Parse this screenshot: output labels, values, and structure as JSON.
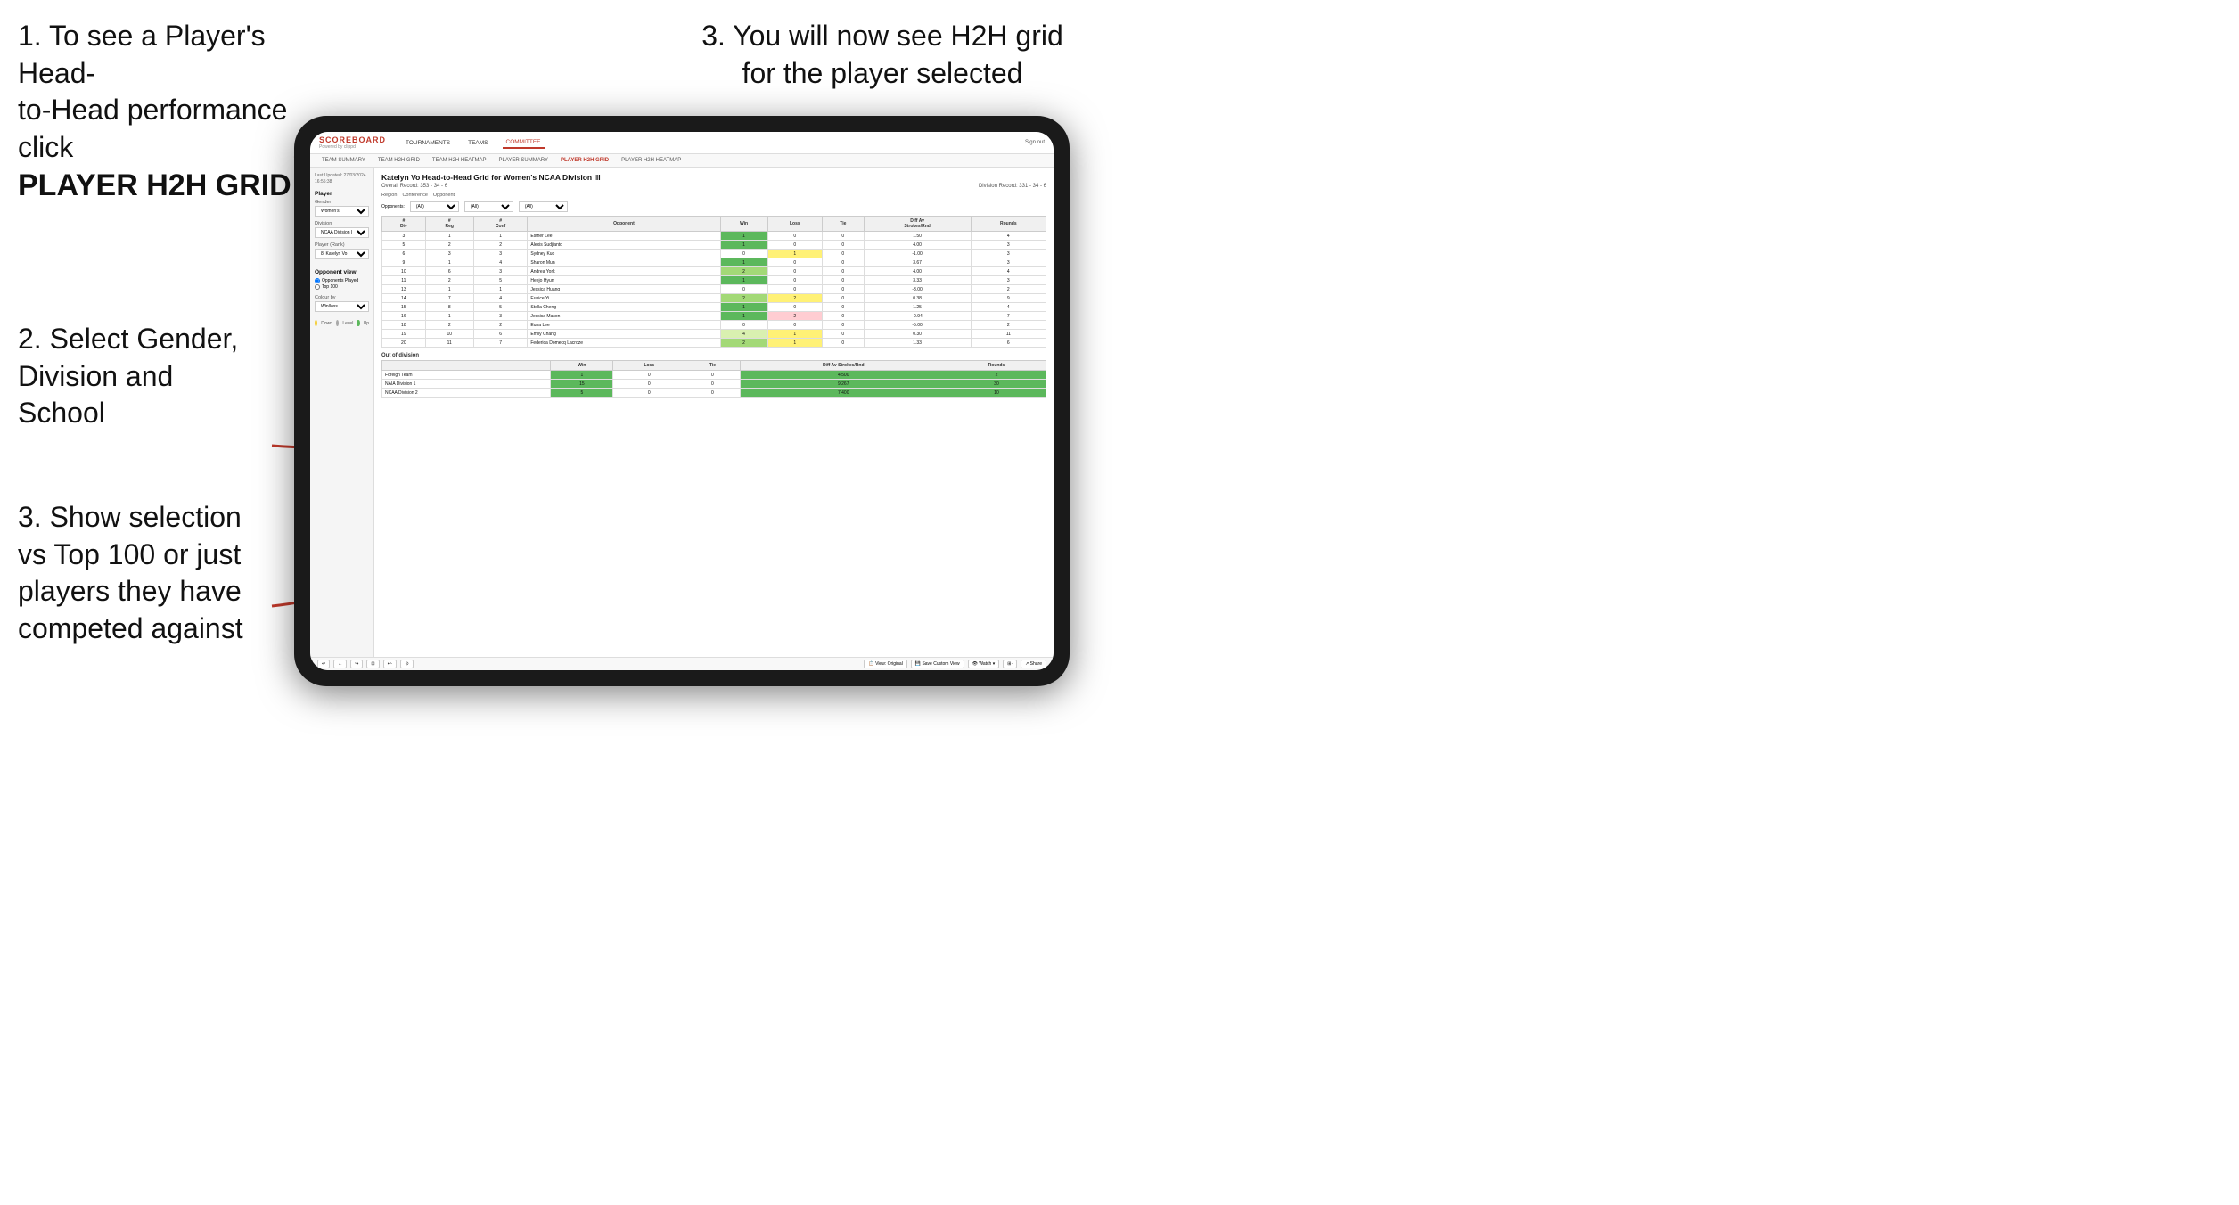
{
  "instructions": {
    "top_left_line1": "1. To see a Player's Head-",
    "top_left_line2": "to-Head performance click",
    "top_left_bold": "PLAYER H2H GRID",
    "top_right": "3. You will now see H2H grid\nfor the player selected",
    "mid_left_line1": "2. Select Gender,",
    "mid_left_line2": "Division and",
    "mid_left_line3": "School",
    "bottom_left_line1": "3. Show selection",
    "bottom_left_line2": "vs Top 100 or just",
    "bottom_left_line3": "players they have",
    "bottom_left_line4": "competed against"
  },
  "nav": {
    "logo": "SCOREBOARD",
    "logo_sub": "Powered by clippd",
    "items": [
      "TOURNAMENTS",
      "TEAMS",
      "COMMITTEE"
    ],
    "sign_out": "Sign out"
  },
  "sub_nav": {
    "items": [
      "TEAM SUMMARY",
      "TEAM H2H GRID",
      "TEAM H2H HEATMAP",
      "PLAYER SUMMARY",
      "PLAYER H2H GRID",
      "PLAYER H2H HEATMAP"
    ],
    "active": "PLAYER H2H GRID"
  },
  "sidebar": {
    "timestamp": "Last Updated: 27/03/2024\n16:55:38",
    "player_section": "Player",
    "gender_label": "Gender",
    "gender_value": "Women's",
    "division_label": "Division",
    "division_value": "NCAA Division III",
    "player_rank_label": "Player (Rank)",
    "player_rank_value": "8. Katelyn Vo",
    "opponent_view_label": "Opponent view",
    "radio_opponents": "Opponents Played",
    "radio_top100": "Top 100",
    "colour_by_label": "Colour by",
    "colour_value": "Win/loss",
    "colour_legend": [
      {
        "color": "#f4d03f",
        "label": "Down"
      },
      {
        "color": "#aaa",
        "label": "Level"
      },
      {
        "color": "#5cb85c",
        "label": "Up"
      }
    ]
  },
  "grid": {
    "title": "Katelyn Vo Head-to-Head Grid for Women's NCAA Division III",
    "overall_record": "Overall Record: 353 - 34 - 6",
    "division_record": "Division Record: 331 - 34 - 6",
    "filter_opponents_label": "Opponents:",
    "filter_opponents_value": "(All)",
    "filter_conference_label": "Conference",
    "filter_conference_value": "(All)",
    "filter_opponent_label": "Opponent",
    "filter_opponent_value": "(All)",
    "region_label": "Region",
    "conference_label": "Conference",
    "opponent_label": "Opponent",
    "columns": [
      "# Div",
      "# Reg",
      "# Conf",
      "Opponent",
      "Win",
      "Loss",
      "Tie",
      "Diff Av Strokes/Rnd",
      "Rounds"
    ],
    "rows": [
      {
        "div": 3,
        "reg": 1,
        "conf": 1,
        "opponent": "Esther Lee",
        "win": 1,
        "loss": 0,
        "tie": 0,
        "diff": 1.5,
        "rounds": 4,
        "win_color": "green-dark",
        "loss_color": "white",
        "tie_color": "white"
      },
      {
        "div": 5,
        "reg": 2,
        "conf": 2,
        "opponent": "Alexis Sudjianto",
        "win": 1,
        "loss": 0,
        "tie": 0,
        "diff": 4.0,
        "rounds": 3,
        "win_color": "green-dark",
        "loss_color": "white",
        "tie_color": "white"
      },
      {
        "div": 6,
        "reg": 3,
        "conf": 3,
        "opponent": "Sydney Kuo",
        "win": 0,
        "loss": 1,
        "tie": 0,
        "diff": -1.0,
        "rounds": 3,
        "win_color": "white",
        "loss_color": "yellow",
        "tie_color": "white"
      },
      {
        "div": 9,
        "reg": 1,
        "conf": 4,
        "opponent": "Sharon Mun",
        "win": 1,
        "loss": 0,
        "tie": 0,
        "diff": 3.67,
        "rounds": 3,
        "win_color": "green-dark",
        "loss_color": "white",
        "tie_color": "white"
      },
      {
        "div": 10,
        "reg": 6,
        "conf": 3,
        "opponent": "Andrea York",
        "win": 2,
        "loss": 0,
        "tie": 0,
        "diff": 4.0,
        "rounds": 4,
        "win_color": "green-mid",
        "loss_color": "white",
        "tie_color": "white"
      },
      {
        "div": 11,
        "reg": 2,
        "conf": 5,
        "opponent": "Heejo Hyun",
        "win": 1,
        "loss": 0,
        "tie": 0,
        "diff": 3.33,
        "rounds": 3,
        "win_color": "green-dark",
        "loss_color": "white",
        "tie_color": "white"
      },
      {
        "div": 13,
        "reg": 1,
        "conf": 1,
        "opponent": "Jessica Huang",
        "win": 0,
        "loss": 0,
        "tie": 0,
        "diff": -3.0,
        "rounds": 2,
        "win_color": "white",
        "loss_color": "white",
        "tie_color": "white"
      },
      {
        "div": 14,
        "reg": 7,
        "conf": 4,
        "opponent": "Eunice Yi",
        "win": 2,
        "loss": 2,
        "tie": 0,
        "diff": 0.38,
        "rounds": 9,
        "win_color": "green-mid",
        "loss_color": "yellow",
        "tie_color": "white"
      },
      {
        "div": 15,
        "reg": 8,
        "conf": 5,
        "opponent": "Stella Cheng",
        "win": 1,
        "loss": 0,
        "tie": 0,
        "diff": 1.25,
        "rounds": 4,
        "win_color": "green-dark",
        "loss_color": "white",
        "tie_color": "white"
      },
      {
        "div": 16,
        "reg": 1,
        "conf": 3,
        "opponent": "Jessica Mason",
        "win": 1,
        "loss": 2,
        "tie": 0,
        "diff": -0.94,
        "rounds": 7,
        "win_color": "green-dark",
        "loss_color": "red-light",
        "tie_color": "white"
      },
      {
        "div": 18,
        "reg": 2,
        "conf": 2,
        "opponent": "Euna Lee",
        "win": 0,
        "loss": 0,
        "tie": 0,
        "diff": -5.0,
        "rounds": 2,
        "win_color": "white",
        "loss_color": "white",
        "tie_color": "white"
      },
      {
        "div": 19,
        "reg": 10,
        "conf": 6,
        "opponent": "Emily Chang",
        "win": 4,
        "loss": 1,
        "tie": 0,
        "diff": 0.3,
        "rounds": 11,
        "win_color": "green-light",
        "loss_color": "yellow",
        "tie_color": "white"
      },
      {
        "div": 20,
        "reg": 11,
        "conf": 7,
        "opponent": "Federica Domecq Lacroze",
        "win": 2,
        "loss": 1,
        "tie": 0,
        "diff": 1.33,
        "rounds": 6,
        "win_color": "green-mid",
        "loss_color": "yellow",
        "tie_color": "white"
      }
    ],
    "out_of_division_label": "Out of division",
    "out_of_division_rows": [
      {
        "name": "Foreign Team",
        "win": 1,
        "loss": 0,
        "tie": 0,
        "diff": 4.5,
        "rounds": 2
      },
      {
        "name": "NAIA Division 1",
        "win": 15,
        "loss": 0,
        "tie": 0,
        "diff": 9.267,
        "rounds": 30
      },
      {
        "name": "NCAA Division 2",
        "win": 5,
        "loss": 0,
        "tie": 0,
        "diff": 7.4,
        "rounds": 10
      }
    ]
  },
  "toolbar": {
    "buttons": [
      "↩",
      "←",
      "↪",
      "⊡",
      "↩·",
      "⊙",
      "View: Original",
      "Save Custom View",
      "Watch ▾",
      "⊞·",
      "↗ Share"
    ]
  }
}
